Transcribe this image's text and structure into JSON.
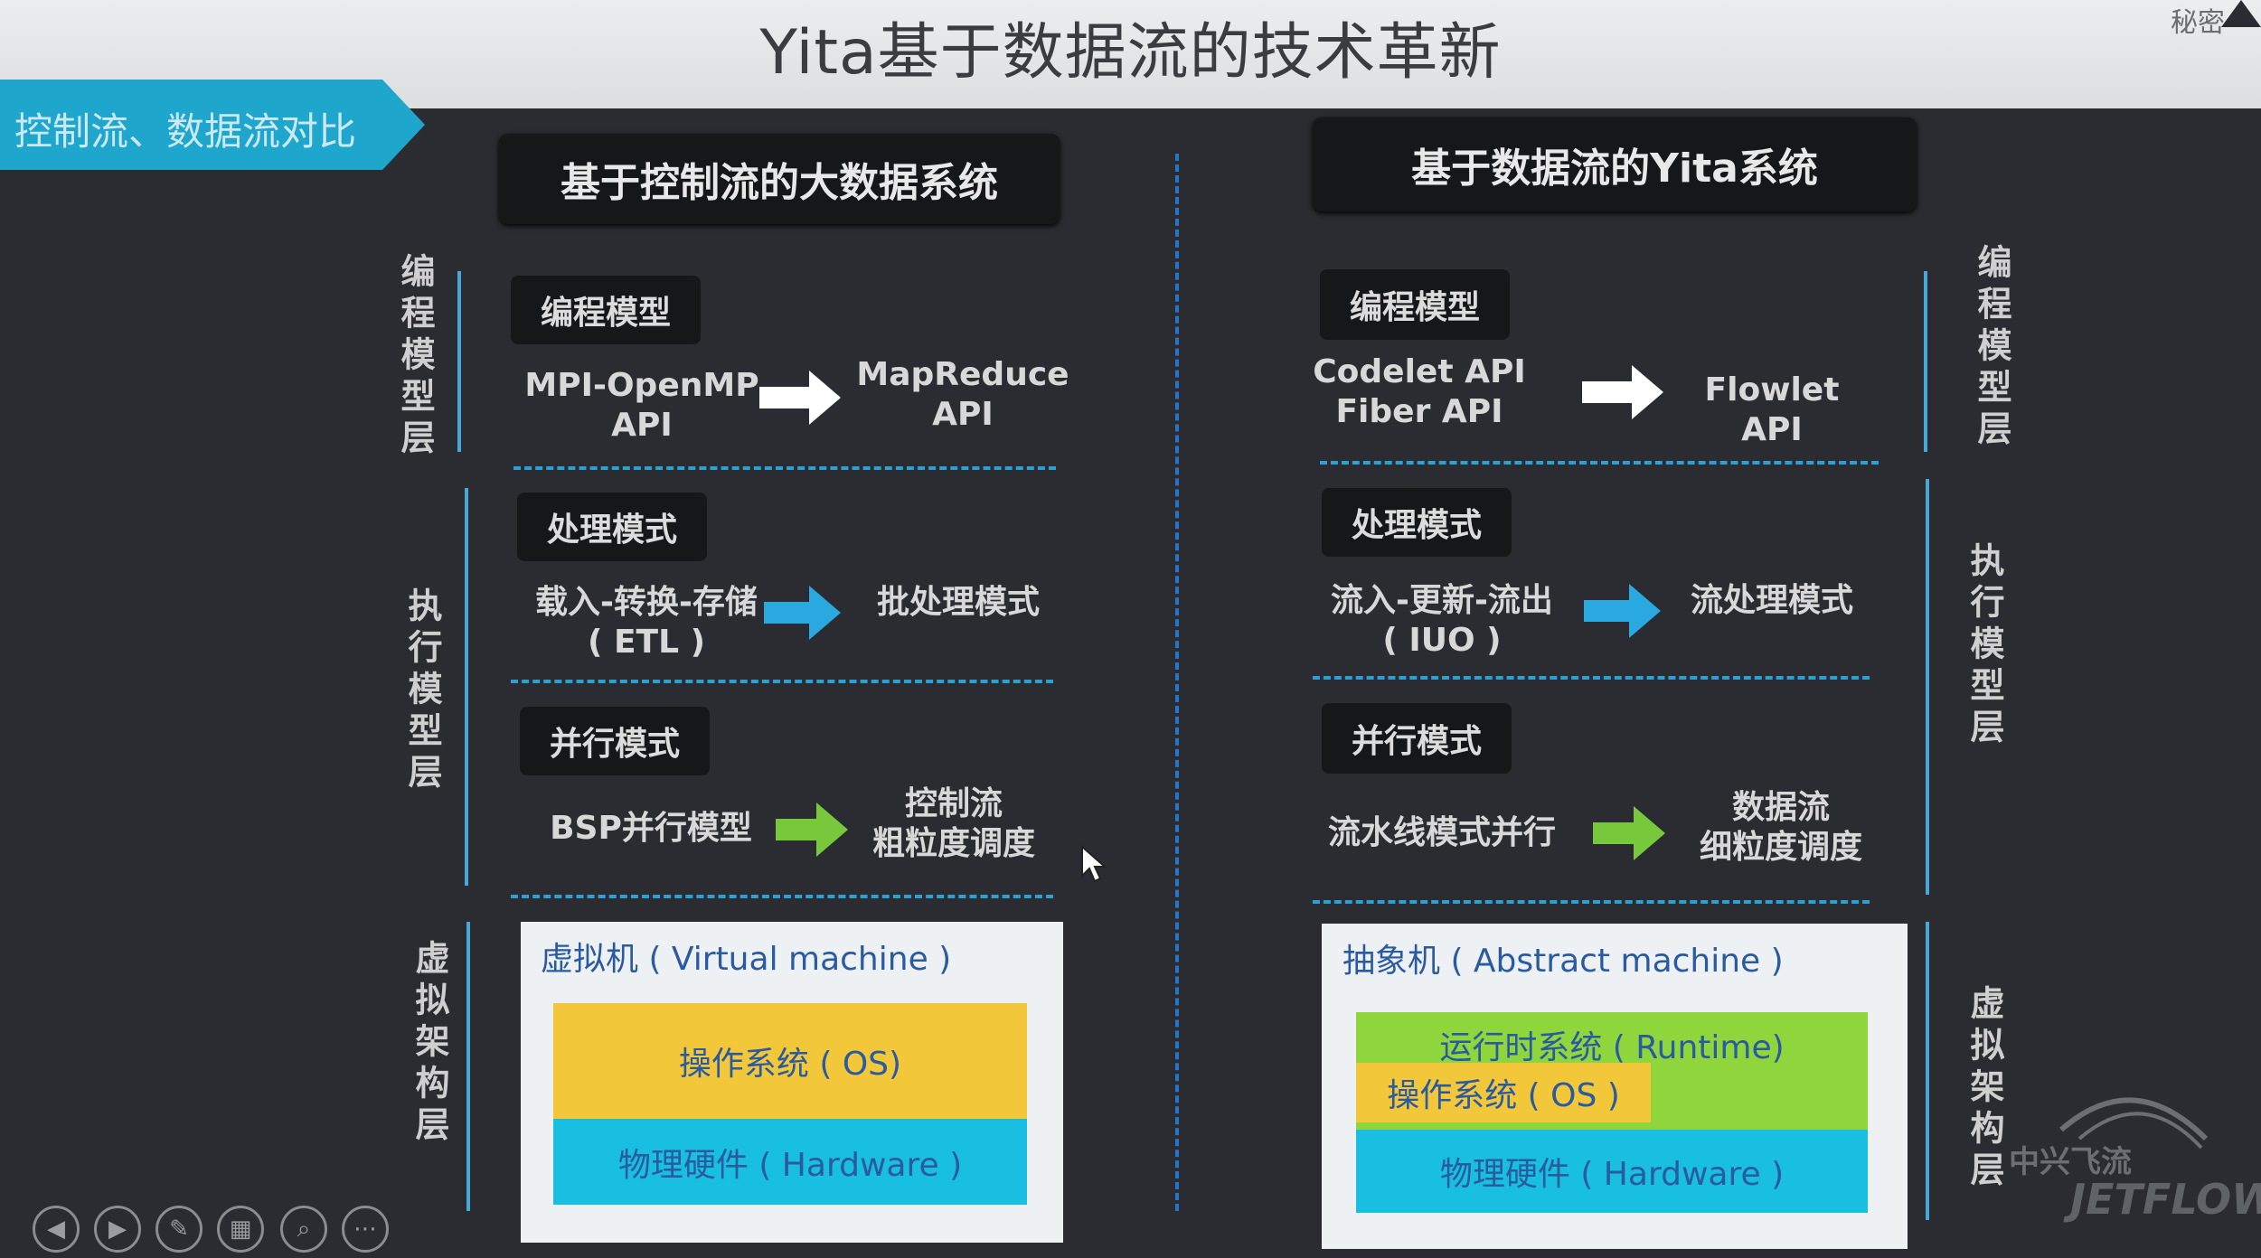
{
  "header": {
    "title": "Yita基于数据流的技术革新",
    "secret_label": "秘密"
  },
  "section_tag": "控制流、数据流对比",
  "left_panel": {
    "title": "基于控制流的大数据系统",
    "rows": [
      {
        "badge": "编程模型",
        "from_lines": [
          "MPI-OpenMP",
          "API"
        ],
        "to_lines": [
          "MapReduce",
          "API"
        ],
        "arrow_color": "#ffffff"
      },
      {
        "badge": "处理模式",
        "from_lines": [
          "载入-转换-存储",
          "( ETL )"
        ],
        "to_lines": [
          "批处理模式"
        ],
        "arrow_color": "#2aa8e0"
      },
      {
        "badge": "并行模式",
        "from_lines": [
          "BSP并行模型"
        ],
        "to_lines": [
          "控制流",
          "粗粒度调度"
        ],
        "arrow_color": "#78c83c"
      }
    ],
    "machine_label": "虚拟机 ( Virtual machine )",
    "os_label": "操作系统 ( OS)",
    "hw_label": "物理硬件 ( Hardware )"
  },
  "right_panel": {
    "title": "基于数据流的Yita系统",
    "rows": [
      {
        "badge": "编程模型",
        "from_lines": [
          "Codelet API",
          "Fiber API"
        ],
        "to_lines": [
          "Flowlet  API"
        ],
        "arrow_color": "#ffffff"
      },
      {
        "badge": "处理模式",
        "from_lines": [
          "流入-更新-流出",
          "( IUO )"
        ],
        "to_lines": [
          "流处理模式"
        ],
        "arrow_color": "#2aa8e0"
      },
      {
        "badge": "并行模式",
        "from_lines": [
          "流水线模式并行"
        ],
        "to_lines": [
          "数据流",
          "细粒度调度"
        ],
        "arrow_color": "#78c83c"
      }
    ],
    "machine_label": "抽象机 ( Abstract machine )",
    "runtime_label": "运行时系统 ( Runtime)",
    "os_label": "操作系统 ( OS )",
    "hw_label": "物理硬件 ( Hardware )"
  },
  "layer_labels": {
    "programming": "编程模型层",
    "execution": "执行模型层",
    "virtual_arch": "虚拟架构层"
  },
  "colors": {
    "os_yellow": "#f2c73a",
    "hw_cyan": "#18bfe0",
    "runtime_green": "#8fd63c"
  },
  "logo": {
    "cn": "中兴飞流",
    "en": "JETFLOW"
  },
  "controls": [
    "prev-icon",
    "next-icon",
    "pen-icon",
    "slides-icon",
    "zoom-icon",
    "more-icon"
  ]
}
